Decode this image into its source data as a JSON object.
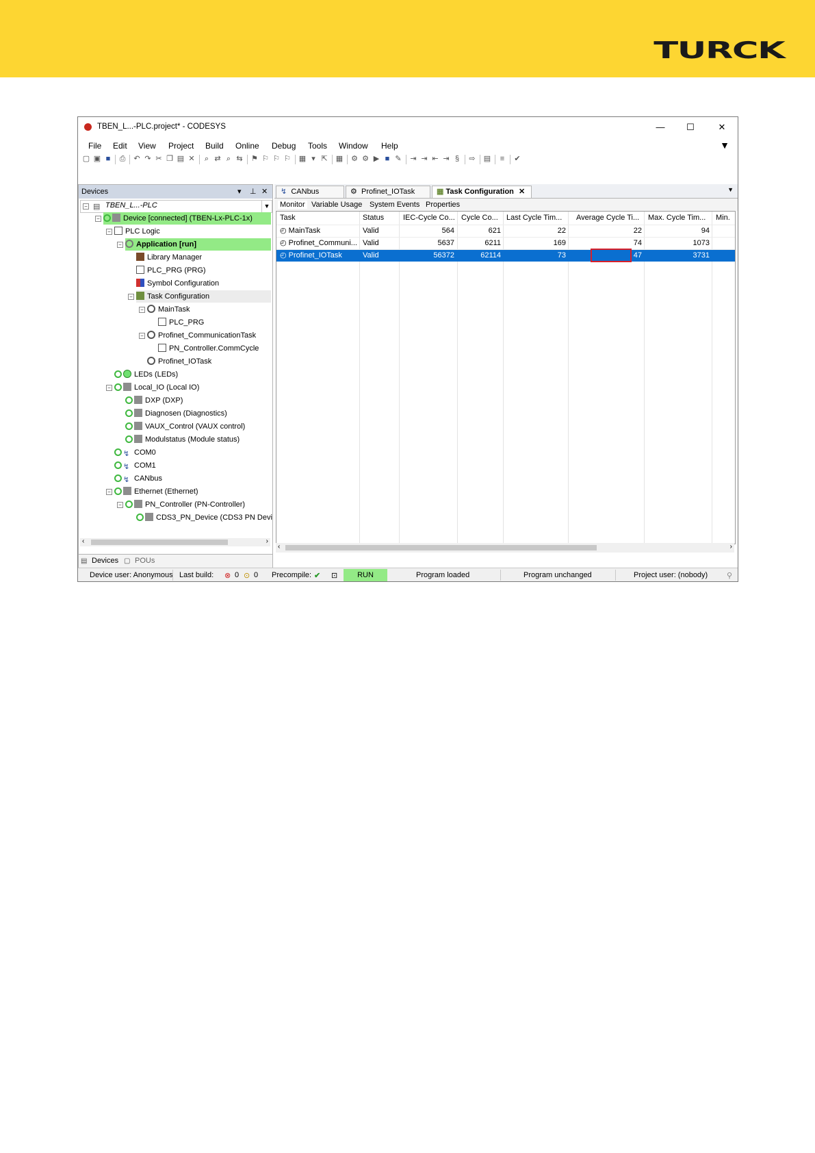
{
  "brand": {
    "logo_text": "TURCK",
    "banner_color": "#fdd632"
  },
  "window": {
    "title": "TBEN_L...-PLC.project* - CODESYS",
    "minimize": "—",
    "maximize": "☐",
    "close": "✕"
  },
  "menu": [
    "File",
    "Edit",
    "View",
    "Project",
    "Build",
    "Online",
    "Debug",
    "Tools",
    "Window",
    "Help"
  ],
  "devices_panel": {
    "title": "Devices",
    "project": "TBEN_L...-PLC",
    "tree": [
      {
        "label": "Device [connected] (TBEN-Lx-PLC-1x)"
      },
      {
        "label": "PLC Logic"
      },
      {
        "label": "Application [run]"
      },
      {
        "label": "Library Manager"
      },
      {
        "label": "PLC_PRG (PRG)"
      },
      {
        "label": "Symbol Configuration"
      },
      {
        "label": "Task Configuration"
      },
      {
        "label": "MainTask"
      },
      {
        "label": "PLC_PRG"
      },
      {
        "label": "Profinet_CommunicationTask"
      },
      {
        "label": "PN_Controller.CommCycle"
      },
      {
        "label": "Profinet_IOTask"
      },
      {
        "label": "LEDs (LEDs)"
      },
      {
        "label": "Local_IO (Local IO)"
      },
      {
        "label": "DXP (DXP)"
      },
      {
        "label": "Diagnosen (Diagnostics)"
      },
      {
        "label": "VAUX_Control (VAUX control)"
      },
      {
        "label": "Modulstatus (Module status)"
      },
      {
        "label": "COM0"
      },
      {
        "label": "COM1"
      },
      {
        "label": "CANbus"
      },
      {
        "label": "Ethernet (Ethernet)"
      },
      {
        "label": "PN_Controller (PN-Controller)"
      },
      {
        "label": "CDS3_PN_Device (CDS3 PN Devi"
      }
    ],
    "bottom_tabs": [
      "Devices",
      "POUs"
    ]
  },
  "editor": {
    "tabs": [
      "CANbus",
      "Profinet_IOTask",
      "Task Configuration"
    ],
    "subtabs": [
      "Monitor",
      "Variable Usage",
      "System Events",
      "Properties"
    ],
    "columns": [
      "Task",
      "Status",
      "IEC-Cycle Co...",
      "Cycle Co...",
      "Last Cycle Tim...",
      "Average Cycle Ti...",
      "Max. Cycle Tim...",
      "Min."
    ],
    "rows": [
      {
        "task": "MainTask",
        "status": "Valid",
        "iec": "564",
        "cycle": "621",
        "last": "22",
        "avg": "22",
        "max": "94"
      },
      {
        "task": "Profinet_Communi...",
        "status": "Valid",
        "iec": "5637",
        "cycle": "6211",
        "last": "169",
        "avg": "74",
        "max": "1073"
      },
      {
        "task": "Profinet_IOTask",
        "status": "Valid",
        "iec": "56372",
        "cycle": "62114",
        "last": "73",
        "avg": "47",
        "max": "3731"
      }
    ]
  },
  "status_bar": {
    "device_user": "Device user: Anonymous",
    "last_build": "Last build:",
    "errors": "0",
    "warnings": "0",
    "precompile": "Precompile:",
    "run": "RUN",
    "program_loaded": "Program loaded",
    "program_unchanged": "Program unchanged",
    "project_user": "Project user: (nobody)"
  }
}
